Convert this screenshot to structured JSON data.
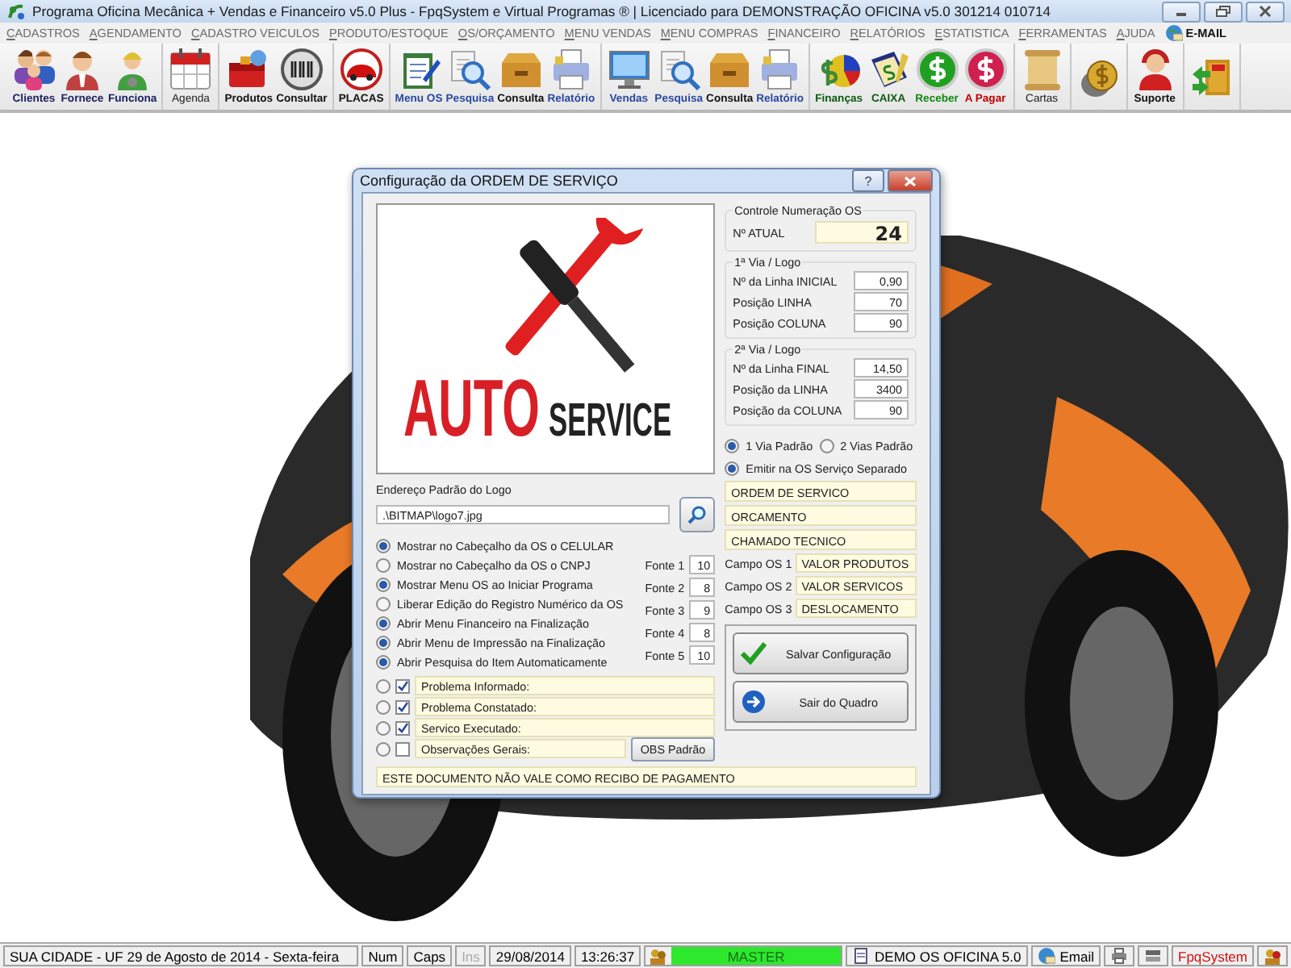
{
  "window": {
    "title": "Programa Oficina Mecânica + Vendas e Financeiro v5.0 Plus - FpqSystem e Virtual Programas ® | Licenciado para  DEMONSTRAÇÃO OFICINA v5.0 301214 010714"
  },
  "menu": [
    {
      "label": "CADASTROS",
      "kind": "text"
    },
    {
      "label": "AGENDAMENTO",
      "kind": "text"
    },
    {
      "label": "CADASTRO VEICULOS",
      "kind": "text"
    },
    {
      "label": "PRODUTO/ESTOQUE",
      "kind": "text"
    },
    {
      "label": "OS/ORÇAMENTO",
      "kind": "text"
    },
    {
      "label": "MENU VENDAS",
      "kind": "text"
    },
    {
      "label": "MENU COMPRAS",
      "kind": "text"
    },
    {
      "label": "FINANCEIRO",
      "kind": "text"
    },
    {
      "label": "RELATÓRIOS",
      "kind": "text"
    },
    {
      "label": "ESTATISTICA",
      "kind": "text"
    },
    {
      "label": "FERRAMENTAS",
      "kind": "text"
    },
    {
      "label": "AJUDA",
      "kind": "text"
    },
    {
      "label": "E-MAIL",
      "kind": "email"
    }
  ],
  "toolbar": [
    [
      {
        "label": "Clientes",
        "kind": "people",
        "color": "#1c2060",
        "bold": true
      },
      {
        "label": "Fornece",
        "kind": "person",
        "color": "#1c2060",
        "bold": true
      },
      {
        "label": "Funciona",
        "kind": "worker",
        "color": "#1c2060",
        "bold": true
      }
    ],
    [
      {
        "label": "Agenda",
        "kind": "calendar",
        "color": "#202020",
        "bold": false
      }
    ],
    [
      {
        "label": "Produtos",
        "kind": "toolbox",
        "color": "#101010",
        "bold": true
      },
      {
        "label": "Consultar",
        "kind": "barcode",
        "color": "#101010",
        "bold": true
      }
    ],
    [
      {
        "label": "PLACAS",
        "kind": "car",
        "color": "#101010",
        "bold": true
      }
    ],
    [
      {
        "label": "Menu OS",
        "kind": "clipboard",
        "color": "#2848a0",
        "bold": true
      },
      {
        "label": "Pesquisa",
        "kind": "magnifier",
        "color": "#2848a0",
        "bold": true
      },
      {
        "label": "Consulta",
        "kind": "drawer",
        "color": "#101010",
        "bold": true
      },
      {
        "label": "Relatório",
        "kind": "printer",
        "color": "#2848a0",
        "bold": true
      }
    ],
    [
      {
        "label": "Vendas",
        "kind": "monitor",
        "color": "#2848a0",
        "bold": true
      },
      {
        "label": "Pesquisa",
        "kind": "magnifier",
        "color": "#2848a0",
        "bold": true
      },
      {
        "label": "Consulta",
        "kind": "drawer",
        "color": "#101010",
        "bold": true
      },
      {
        "label": "Relatório",
        "kind": "printer",
        "color": "#2848a0",
        "bold": true
      }
    ],
    [
      {
        "label": "Finanças",
        "kind": "chart",
        "color": "#0c5a10",
        "bold": true
      },
      {
        "label": "CAIXA",
        "kind": "book",
        "color": "#0c5a10",
        "bold": true
      },
      {
        "label": "Receber",
        "kind": "dollar-green",
        "color": "#118a11",
        "bold": true
      },
      {
        "label": "A Pagar",
        "kind": "dollar-red",
        "color": "#c00000",
        "bold": true
      }
    ],
    [
      {
        "label": "Cartas",
        "kind": "scroll",
        "color": "#202020",
        "bold": false
      }
    ],
    [
      {
        "kind": "coin"
      }
    ],
    [
      {
        "label": "Suporte",
        "kind": "headset",
        "color": "#101010",
        "bold": true
      }
    ],
    [
      {
        "kind": "exit"
      }
    ]
  ],
  "dialog": {
    "title": "Configuração da ORDEM DE SERVIÇO",
    "help_button": "?",
    "logo": {
      "word_1": "AUTO",
      "word_2": "SERVICE"
    },
    "logo_path": {
      "label": "Endereço Padrão do Logo",
      "value": ".\\BITMAP\\logo7.jpg"
    },
    "options": [
      {
        "label": "Mostrar no Cabeçalho da OS o CELULAR",
        "checked": true
      },
      {
        "label": "Mostrar no Cabeçalho da OS o CNPJ",
        "checked": false
      },
      {
        "label": "Mostrar Menu OS ao Iniciar Programa",
        "checked": true
      },
      {
        "label": "Liberar Edição do Registro Numérico da OS",
        "checked": false
      },
      {
        "label": "Abrir Menu Financeiro na Finalização",
        "checked": true
      },
      {
        "label": "Abrir Menu de Impressão na Finalização",
        "checked": true
      },
      {
        "label": "Abrir Pesquisa do Item Automaticamente",
        "checked": true
      }
    ],
    "fonts": [
      {
        "label": "Fonte 1",
        "value": "10"
      },
      {
        "label": "Fonte 2",
        "value": "8"
      },
      {
        "label": "Fonte 3",
        "value": "9"
      },
      {
        "label": "Fonte 4",
        "value": "8"
      },
      {
        "label": "Fonte 5",
        "value": "10"
      }
    ],
    "sections": [
      {
        "label": "Problema Informado:",
        "selected": false,
        "checked": true
      },
      {
        "label": "Problema Constatado:",
        "selected": false,
        "checked": true
      },
      {
        "label": "Servico Executado:",
        "selected": false,
        "checked": true
      },
      {
        "label": "Observações Gerais:",
        "selected": false,
        "checked": false
      }
    ],
    "obs_button": "OBS Padrão",
    "footer": "ESTE DOCUMENTO NÃO VALE COMO RECIBO DE PAGAMENTO",
    "numbering": {
      "title": "Controle Numeração OS",
      "label": "Nº ATUAL",
      "value": "24"
    },
    "groups": [
      {
        "title": "1ª Via / Logo",
        "fields": [
          {
            "label": "Nº da Linha INICIAL",
            "value": "0,90"
          },
          {
            "label": "Posição LINHA",
            "value": "70"
          },
          {
            "label": "Posição COLUNA",
            "value": "90"
          }
        ]
      },
      {
        "title": "2ª Via / Logo",
        "fields": [
          {
            "label": "Nº da Linha FINAL",
            "value": "14,50"
          },
          {
            "label": "Posição da LINHA",
            "value": "3400"
          },
          {
            "label": "Posição da COLUNA",
            "value": "90"
          }
        ]
      }
    ],
    "copies": [
      {
        "label": "1 Via Padrão",
        "selected": true
      },
      {
        "label": "2 Vias Padrão",
        "selected": false
      }
    ],
    "separate": {
      "label": "Emitir na OS Serviço Separado",
      "checked": true
    },
    "doc_titles": [
      "ORDEM DE SERVICO",
      "ORCAMENTO",
      "CHAMADO TECNICO"
    ],
    "custom_fields": [
      {
        "label": "Campo OS 1",
        "value": "VALOR PRODUTOS"
      },
      {
        "label": "Campo OS 2",
        "value": "VALOR SERVICOS"
      },
      {
        "label": "Campo OS 3",
        "value": "DESLOCAMENTO"
      }
    ],
    "buttons": [
      {
        "label": "Salvar Configuração",
        "kind": "save"
      },
      {
        "label": "Sair do Quadro",
        "kind": "exit"
      }
    ]
  },
  "status_bar": {
    "location": "SUA CIDADE - UF 29 de Agosto de 2014 - Sexta-feira",
    "keys": [
      {
        "label": "Num",
        "disabled": false
      },
      {
        "label": "Caps",
        "disabled": false
      },
      {
        "label": "Ins",
        "disabled": true
      }
    ],
    "date": "29/08/2014",
    "time": "13:26:37",
    "user": "MASTER",
    "company": "DEMO OS OFICINA 5.0",
    "email": "Email",
    "brand": "FpqSystem"
  }
}
